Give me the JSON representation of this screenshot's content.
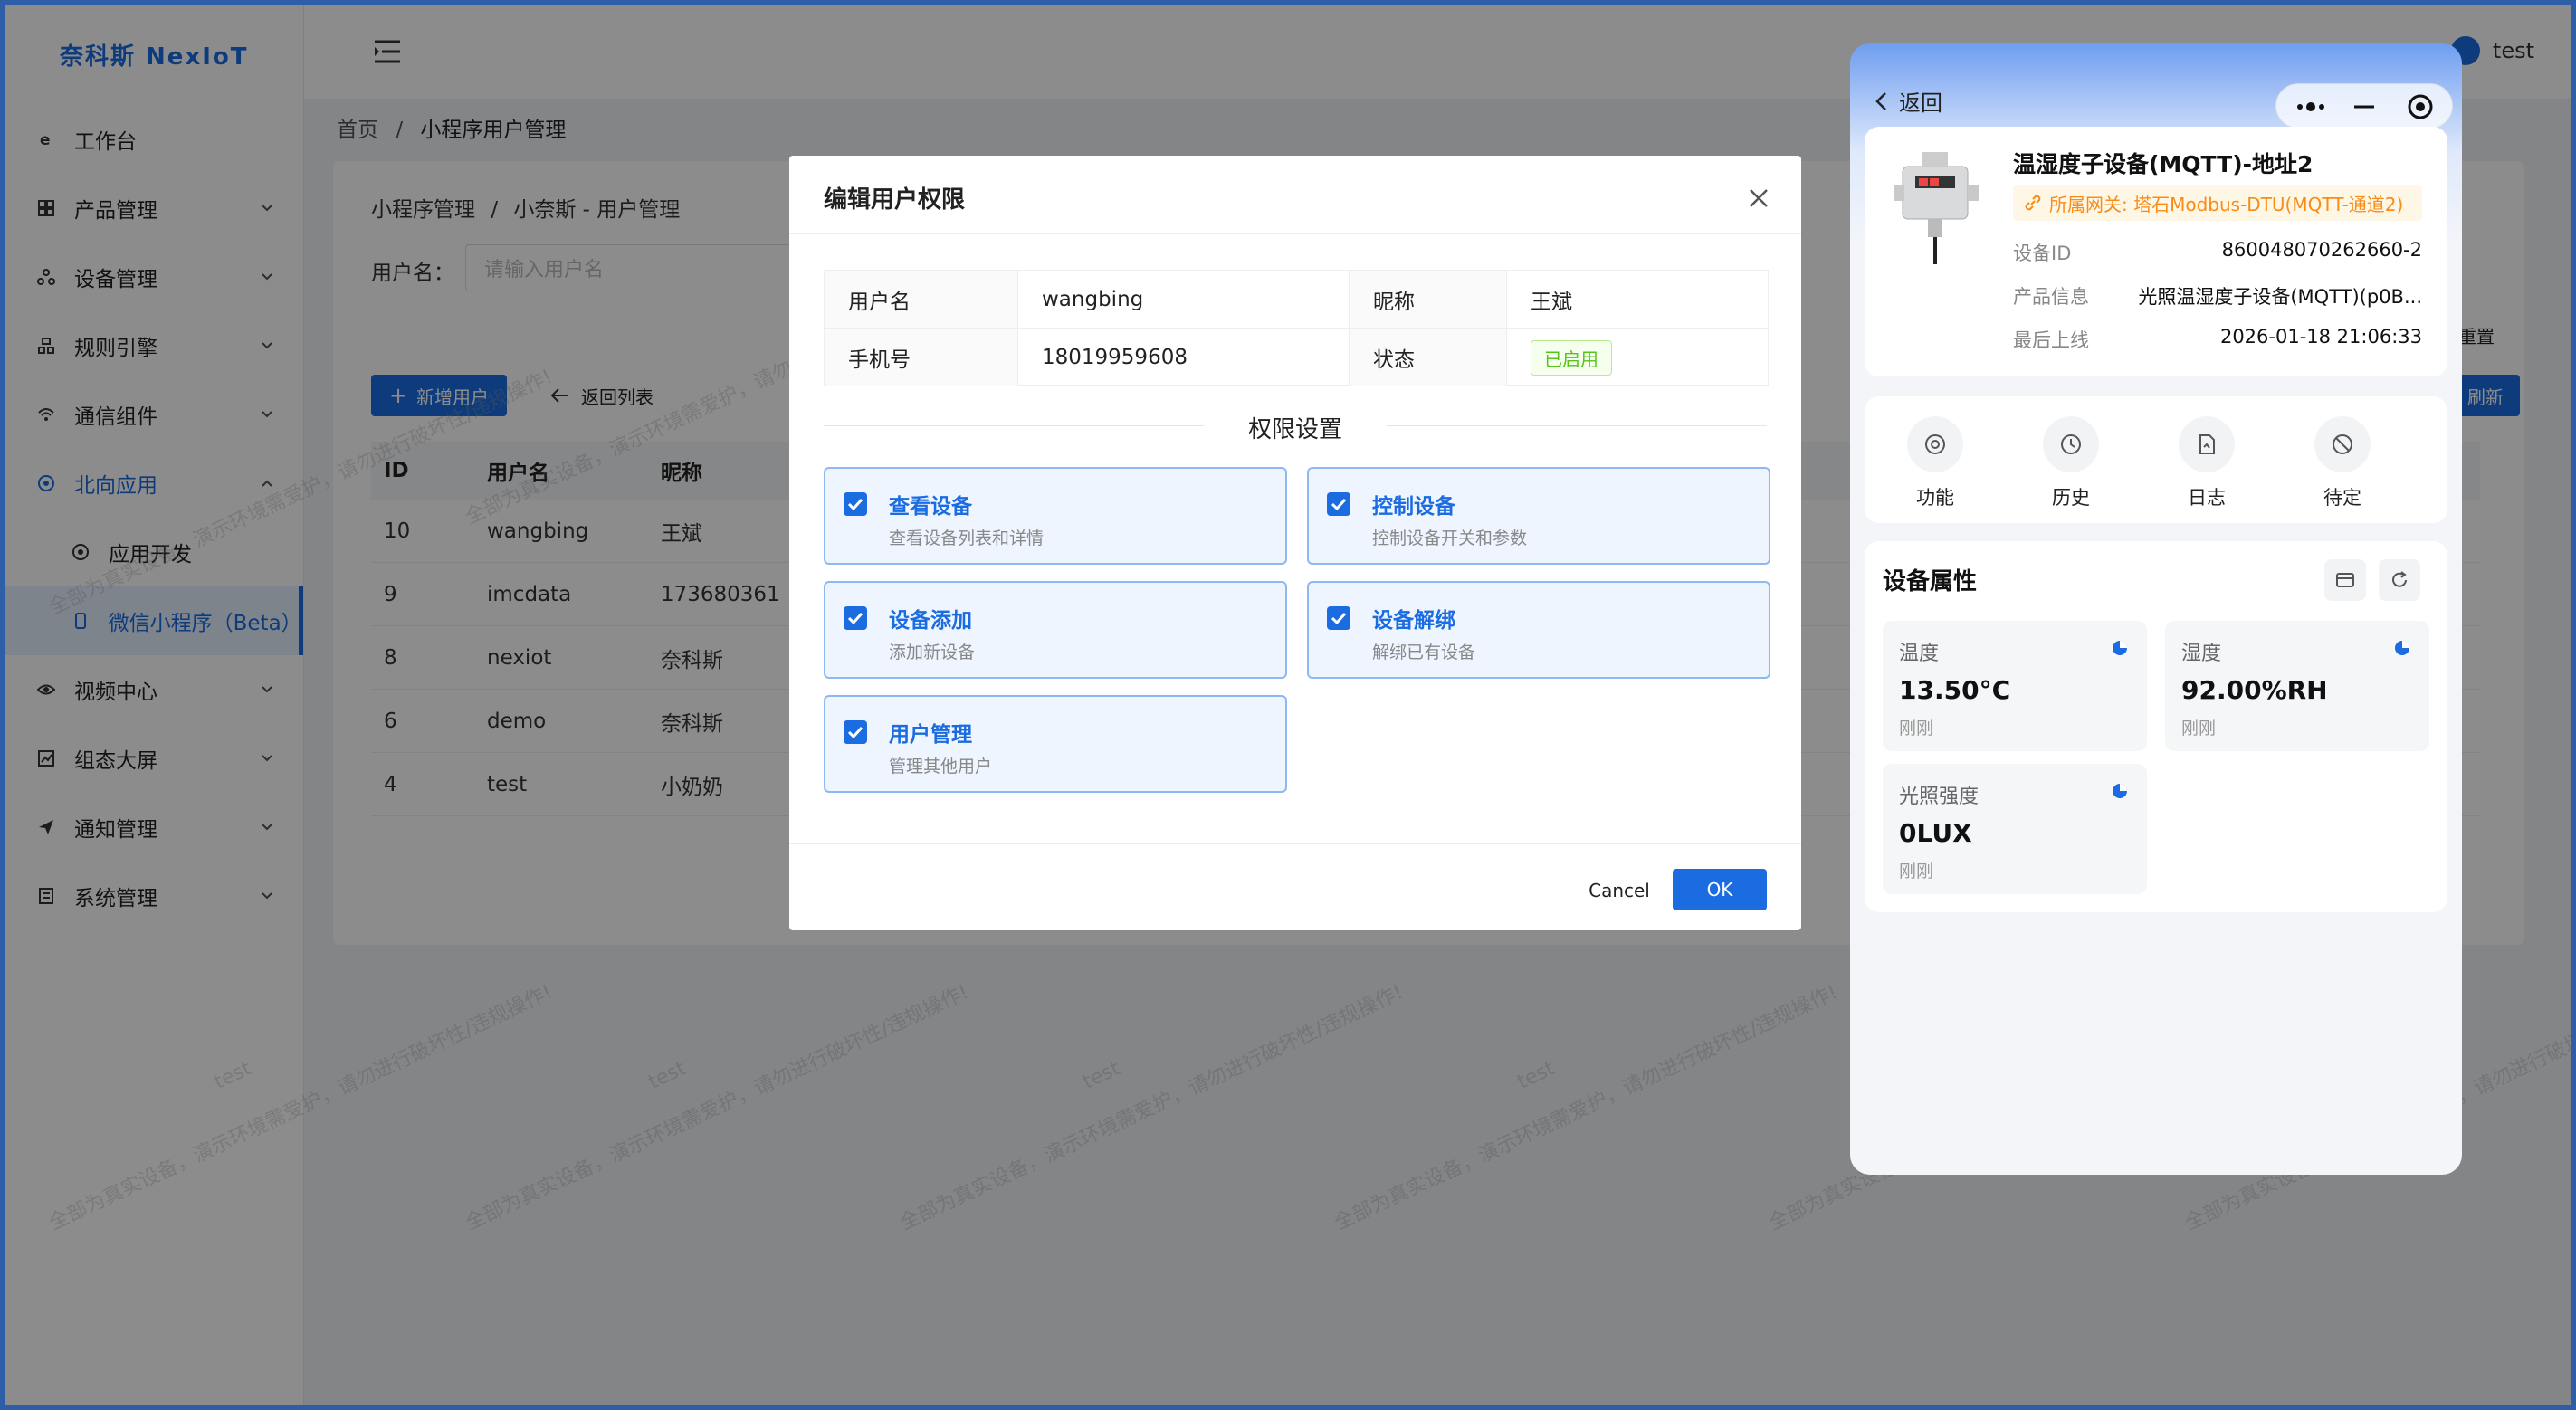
{
  "app": {
    "logo": "奈科斯 NexIoT"
  },
  "sidebar": {
    "items": [
      {
        "label": "工作台",
        "icon": "workbench-icon"
      },
      {
        "label": "产品管理",
        "icon": "product-icon"
      },
      {
        "label": "设备管理",
        "icon": "device-icon"
      },
      {
        "label": "规则引擎",
        "icon": "rule-icon"
      },
      {
        "label": "通信组件",
        "icon": "wifi-icon"
      },
      {
        "label": "北向应用",
        "icon": "app-icon"
      },
      {
        "label": "应用开发",
        "icon": "dev-icon"
      },
      {
        "label": "微信小程序（Beta）",
        "icon": "phone-icon"
      },
      {
        "label": "视频中心",
        "icon": "eye-icon"
      },
      {
        "label": "组态大屏",
        "icon": "chart-icon"
      },
      {
        "label": "通知管理",
        "icon": "send-icon"
      },
      {
        "label": "系统管理",
        "icon": "system-icon"
      }
    ]
  },
  "header": {
    "username": "test"
  },
  "breadcrumb": {
    "home": "首页",
    "sep": "/",
    "current": "小程序用户管理"
  },
  "content": {
    "crumb": {
      "a": "小程序管理",
      "sep": "/",
      "b": "小奈斯 - 用户管理"
    },
    "filter_label": "用户名：",
    "filter_placeholder": "请输入用户名",
    "add_button": "新增用户",
    "back_button": "返回列表",
    "reset_button": "重置",
    "refresh_button": "刷新",
    "columns": [
      "ID",
      "用户名",
      "昵称"
    ],
    "rows": [
      {
        "id": "10",
        "name": "wangbing",
        "nick": "王斌"
      },
      {
        "id": "9",
        "name": "imcdata",
        "nick": "173680361"
      },
      {
        "id": "8",
        "name": "nexiot",
        "nick": "奈科斯"
      },
      {
        "id": "6",
        "name": "demo",
        "nick": "奈科斯"
      },
      {
        "id": "4",
        "name": "test",
        "nick": "小奶奶"
      }
    ]
  },
  "watermark": "全部为真实设备，演示环境需爱护，请勿进行破坏性/违规操作!",
  "watermark_short": "test",
  "modal": {
    "title": "编辑用户权限",
    "info": {
      "username_label": "用户名",
      "username": "wangbing",
      "nickname_label": "昵称",
      "nickname": "王斌",
      "phone_label": "手机号",
      "phone": "18019959608",
      "status_label": "状态",
      "status": "已启用"
    },
    "perm_title": "权限设置",
    "permissions": [
      {
        "name": "查看设备",
        "desc": "查看设备列表和详情",
        "checked": true
      },
      {
        "name": "控制设备",
        "desc": "控制设备开关和参数",
        "checked": true
      },
      {
        "name": "设备添加",
        "desc": "添加新设备",
        "checked": true
      },
      {
        "name": "设备解绑",
        "desc": "解绑已有设备",
        "checked": true
      },
      {
        "name": "用户管理",
        "desc": "管理其他用户",
        "checked": true
      }
    ],
    "cancel": "Cancel",
    "ok": "OK"
  },
  "phone": {
    "back": "返回",
    "device": {
      "title": "温湿度子设备(MQTT)-地址2",
      "gateway": "所属网关: 塔石Modbus-DTU(MQTT-通道2)",
      "id_label": "设备ID",
      "id": "860048070262660-2",
      "product_label": "产品信息",
      "product": "光照温湿度子设备(MQTT)(p0B...",
      "online_label": "最后上线",
      "online": "2026-01-18 21:06:33"
    },
    "actions": [
      "功能",
      "历史",
      "日志",
      "待定"
    ],
    "props_title": "设备属性",
    "props": [
      {
        "name": "温度",
        "value": "13.50°C",
        "time": "刚刚"
      },
      {
        "name": "湿度",
        "value": "92.00%RH",
        "time": "刚刚"
      },
      {
        "name": "光照强度",
        "value": "0LUX",
        "time": "刚刚"
      }
    ]
  },
  "colors": {
    "primary": "#1b6ce0",
    "success": "#52c41a",
    "warning": "#fa8c16"
  }
}
